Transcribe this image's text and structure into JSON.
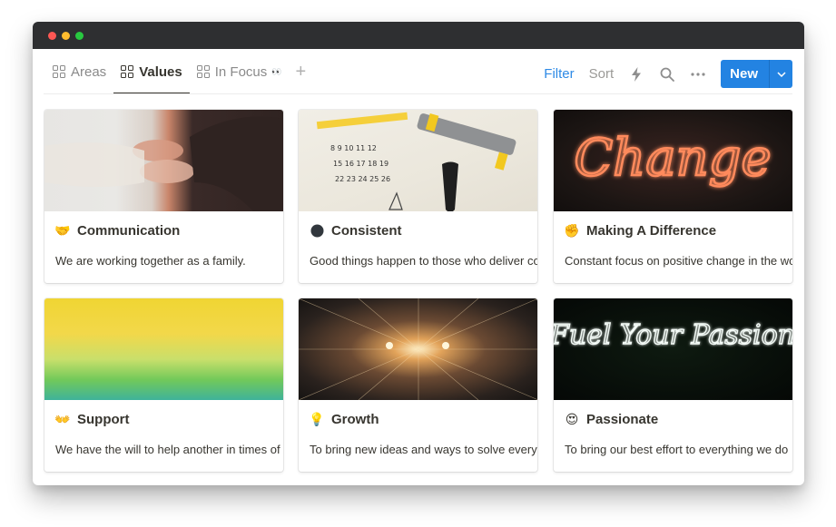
{
  "window": {
    "controls": [
      "close",
      "minimize",
      "maximize"
    ]
  },
  "tabs": [
    {
      "label": "Areas",
      "icon": "grid-icon",
      "active": false
    },
    {
      "label": "Values",
      "icon": "grid-icon",
      "active": true
    },
    {
      "label": "In Focus",
      "icon": "grid-icon",
      "suffix": "👀",
      "active": false
    }
  ],
  "add_tab_label": "+",
  "actions": {
    "filter": "Filter",
    "sort": "Sort",
    "automation_icon": "lightning-icon",
    "search_icon": "search-icon",
    "more_label": "•••",
    "new_label": "New",
    "new_dropdown_icon": "chevron-down-icon"
  },
  "colors": {
    "accent": "#2383e2",
    "filter_active": "#2e8ae6",
    "text": "#37352f",
    "titlebar": "#2e2f31"
  },
  "cards": [
    {
      "title": "Communication",
      "emoji": "🤝",
      "description": "We are working together as a family.",
      "cover": "hands"
    },
    {
      "title": "Consistent",
      "emoji": "⚫",
      "description": "Good things happen to those who deliver consistently",
      "cover": "calendar"
    },
    {
      "title": "Making A Difference",
      "emoji": "✊",
      "description": "Constant focus on positive change in the world",
      "cover": "change"
    },
    {
      "title": "Support",
      "emoji": "👐",
      "description": "We have the will to help another in times of need",
      "cover": "support"
    },
    {
      "title": "Growth",
      "emoji": "💡",
      "description": "To bring new ideas and ways to solve every problem",
      "cover": "growth"
    },
    {
      "title": "Passionate",
      "emoji": "😍",
      "description": "To bring our best effort to everything we do",
      "cover": "passion"
    }
  ],
  "cover_texts": {
    "change": "Change",
    "passion": "Fuel Your Passion"
  }
}
